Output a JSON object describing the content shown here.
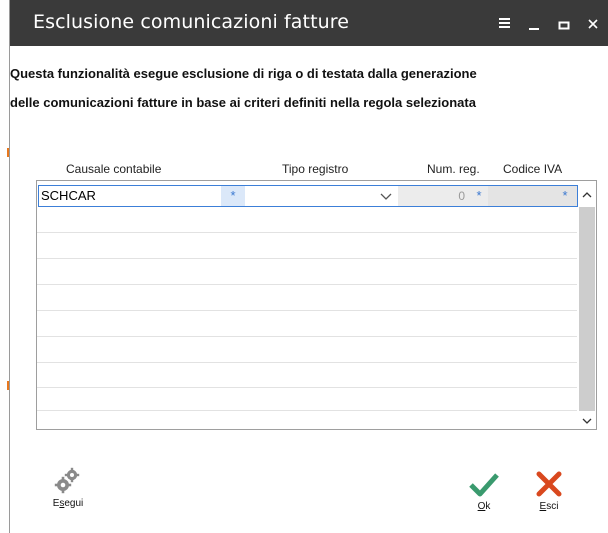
{
  "window": {
    "title": "Esclusione comunicazioni fatture",
    "controls": [
      "menu-icon",
      "minimize-icon",
      "maximize-icon",
      "close-icon"
    ]
  },
  "description": {
    "line1": "Questa funzionalità esegue esclusione di riga o di testata dalla generazione",
    "line2": "delle comunicazioni fatture in base ai criteri definiti nella regola selezionata"
  },
  "grid": {
    "columns": [
      "Causale contabile",
      "Tipo registro",
      "Num. reg.",
      "Codice IVA"
    ],
    "rows": [
      {
        "causale": "SCHCAR",
        "causale_wildcard": "*",
        "tipo_registro": "",
        "num_reg": "0",
        "num_reg_wildcard": "*",
        "codice_iva": "",
        "codice_iva_wildcard": "*"
      }
    ],
    "empty_rows": 9
  },
  "buttons": {
    "esegui": {
      "prefix": "E",
      "underlined": "s",
      "suffix": "egui",
      "icon": "gears-icon"
    },
    "ok": {
      "prefix": "",
      "underlined": "O",
      "suffix": "k",
      "icon": "checkmark-icon"
    },
    "esci": {
      "prefix": "",
      "underlined": "E",
      "suffix": "sci",
      "icon": "x-icon"
    }
  },
  "colors": {
    "titlebar": "#3a3a3a",
    "selection_border": "#3c7fd8",
    "ok_green": "#3a9a6e",
    "esci_red": "#d9481e"
  }
}
